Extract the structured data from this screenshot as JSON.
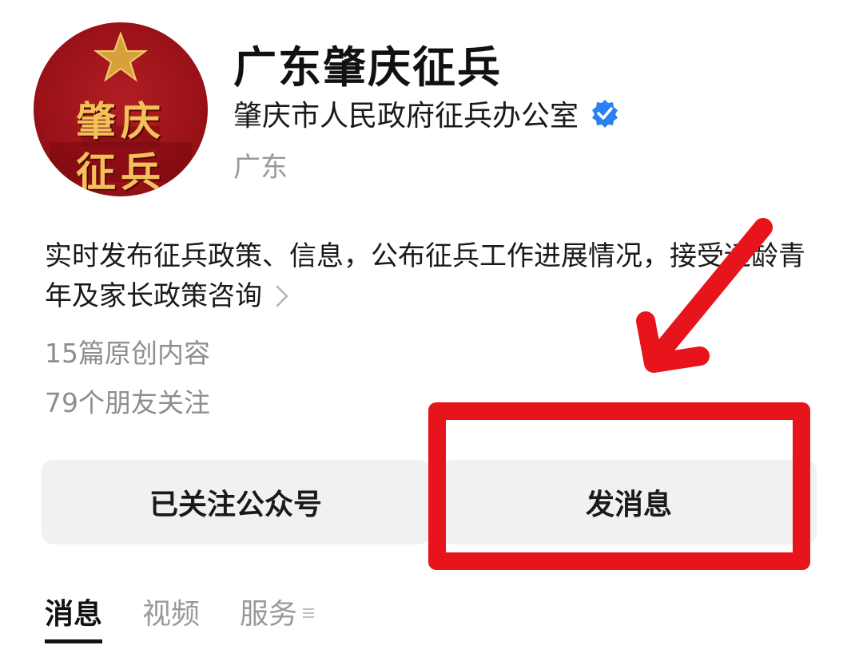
{
  "account": {
    "name": "广东肇庆征兵",
    "owner": "肇庆市人民政府征兵办公室",
    "region": "广东",
    "avatar_text": [
      "肇庆",
      "征兵"
    ],
    "verified_icon": "verified-badge-icon",
    "brand_colors": {
      "avatar_red": "#9a1218",
      "avatar_gold": "#f2c15a",
      "verified_blue": "#2b7ff0"
    }
  },
  "description": {
    "text": "实时发布征兵政策、信息，公布征兵工作进展情况，接受适龄青年及家长政策咨询"
  },
  "stats": {
    "original": "15篇原创内容",
    "friends": "79个朋友关注"
  },
  "actions": {
    "follow_label": "已关注公众号",
    "message_label": "发消息"
  },
  "tabs": [
    {
      "label": "消息",
      "active": true
    },
    {
      "label": "视频",
      "active": false
    },
    {
      "label": "服务",
      "active": false
    }
  ],
  "annotation": {
    "color": "#e8141b",
    "arrow_icon": "red-arrow-icon",
    "box_target": "发消息"
  }
}
